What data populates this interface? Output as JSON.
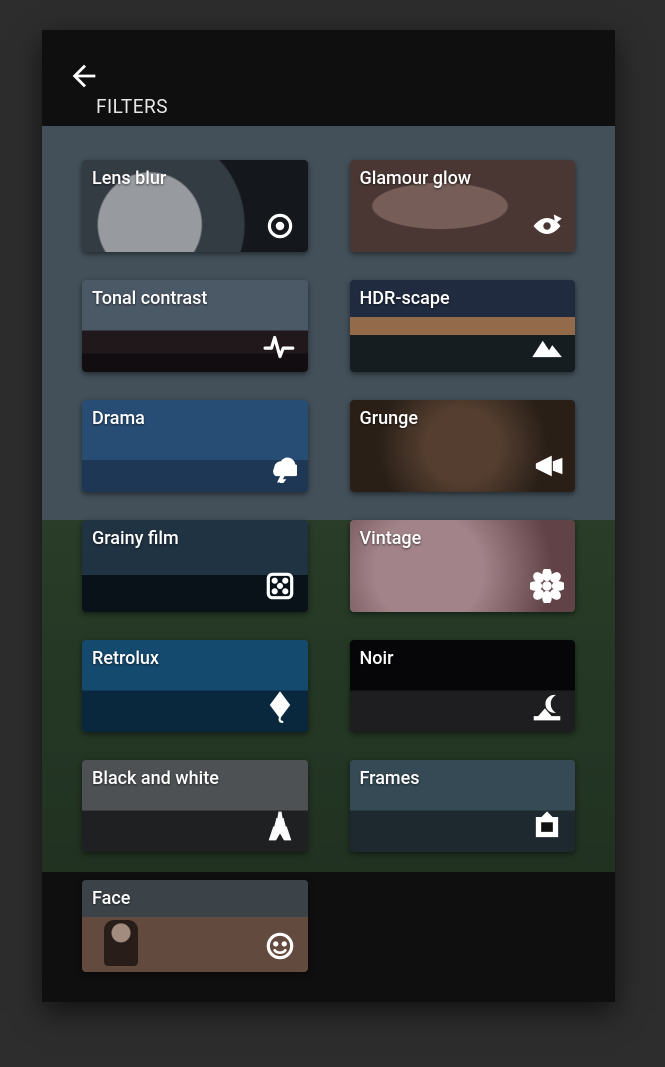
{
  "header": {
    "title": "FILTERS"
  },
  "filters": [
    {
      "id": "lens-blur",
      "label": "Lens blur",
      "icon": "target-icon",
      "thumb": "thumb-lensblur"
    },
    {
      "id": "glamour-glow",
      "label": "Glamour glow",
      "icon": "eye-icon",
      "thumb": "thumb-glamour"
    },
    {
      "id": "tonal-contrast",
      "label": "Tonal contrast",
      "icon": "pulse-icon",
      "thumb": "thumb-tonal"
    },
    {
      "id": "hdr-scape",
      "label": "HDR-scape",
      "icon": "mountains-icon",
      "thumb": "thumb-hdr"
    },
    {
      "id": "drama",
      "label": "Drama",
      "icon": "storm-icon",
      "thumb": "thumb-drama"
    },
    {
      "id": "grunge",
      "label": "Grunge",
      "icon": "megaphone-icon",
      "thumb": "thumb-grunge"
    },
    {
      "id": "grainy-film",
      "label": "Grainy film",
      "icon": "dice-icon",
      "thumb": "thumb-grainy"
    },
    {
      "id": "vintage",
      "label": "Vintage",
      "icon": "flower-icon",
      "thumb": "thumb-vintage"
    },
    {
      "id": "retrolux",
      "label": "Retrolux",
      "icon": "kite-icon",
      "thumb": "thumb-retrolux"
    },
    {
      "id": "noir",
      "label": "Noir",
      "icon": "night-icon",
      "thumb": "thumb-noir"
    },
    {
      "id": "black-and-white",
      "label": "Black and white",
      "icon": "eiffel-icon",
      "thumb": "thumb-bw"
    },
    {
      "id": "frames",
      "label": "Frames",
      "icon": "frame-icon",
      "thumb": "thumb-frames"
    },
    {
      "id": "face",
      "label": "Face",
      "icon": "face-icon",
      "thumb": "thumb-face"
    }
  ]
}
